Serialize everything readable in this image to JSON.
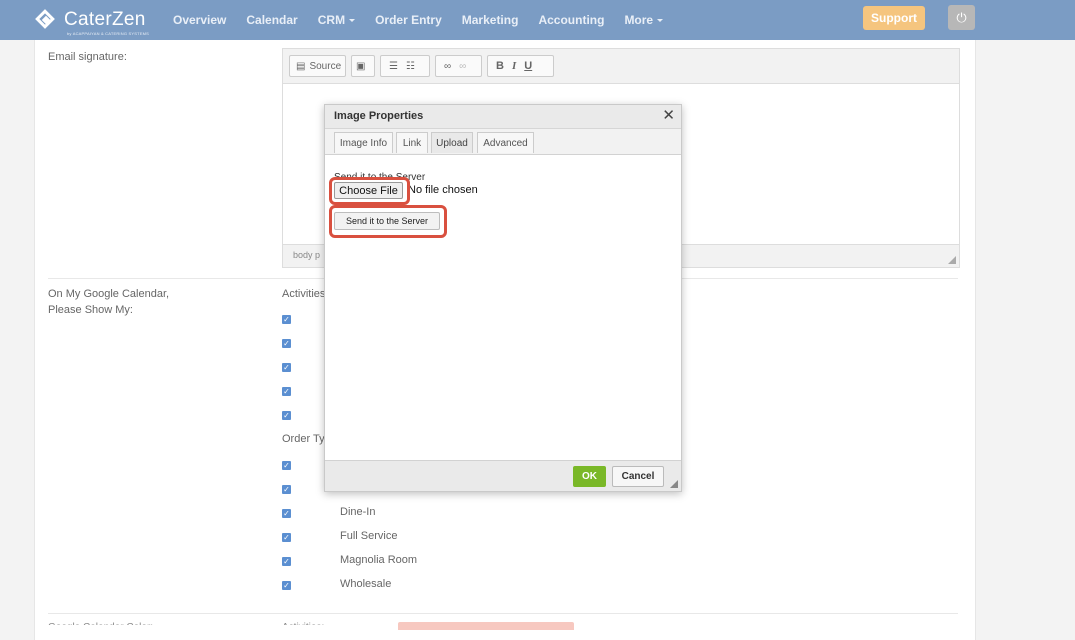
{
  "brand": {
    "name": "CaterZen",
    "subtitle": "by ACAPPAIYAN & CATERING SYSTEMS"
  },
  "nav": [
    {
      "label": "Overview"
    },
    {
      "label": "Calendar"
    },
    {
      "label": "CRM",
      "dropdown": true
    },
    {
      "label": "Order Entry"
    },
    {
      "label": "Marketing"
    },
    {
      "label": "Accounting"
    },
    {
      "label": "More",
      "dropdown": true
    }
  ],
  "header": {
    "support_label": "Support",
    "power_icon": "⏻"
  },
  "settings": {
    "email_signature_label": "Email signature:",
    "calendar_label_line1": "On My Google Calendar,",
    "calendar_label_line2": "Please Show My:",
    "activities_heading": "Activities",
    "order_types_heading": "Order Ty",
    "order_types": [
      "Dine-In",
      "Full Service",
      "Magnolia Room",
      "Wholesale"
    ],
    "partial_heading_left": "Google Calendar Color:",
    "partial_heading_mid": "Activities:"
  },
  "editor": {
    "toolbar": {
      "source_label": "Source",
      "bold": "B",
      "italic": "I",
      "underline": "U"
    },
    "status_path": "body  p"
  },
  "dialog": {
    "title": "Image Properties",
    "close_glyph": "✕",
    "tabs": [
      {
        "label": "Image Info",
        "active": false
      },
      {
        "label": "Link",
        "active": false
      },
      {
        "label": "Upload",
        "active": true
      },
      {
        "label": "Advanced",
        "active": false
      }
    ],
    "upload": {
      "send_label": "Send it to the Server",
      "choose_file_label": "Choose File",
      "file_status": "No file chosen",
      "send_button_label": "Send it to the Server"
    },
    "footer": {
      "ok_label": "OK",
      "cancel_label": "Cancel"
    }
  },
  "colors": {
    "nav_bg": "#7b9cc4",
    "support_bg": "#f5c57f",
    "ok_bg": "#7ab828",
    "highlight": "#d9503f",
    "checkbox": "#5b8fd1"
  }
}
